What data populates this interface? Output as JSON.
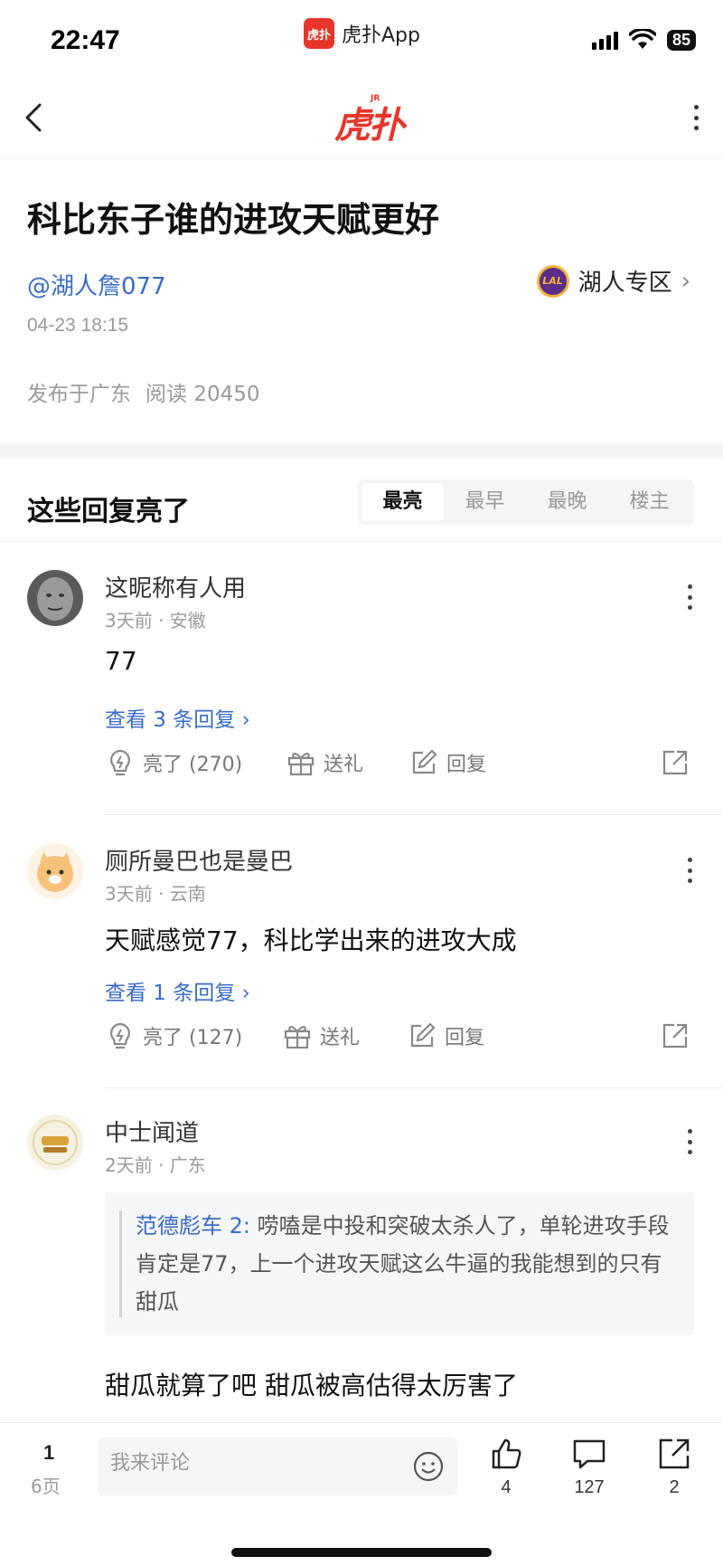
{
  "status_bar": {
    "time": "22:47",
    "app_logo": "虎扑",
    "app_name": "虎扑App",
    "battery": "85",
    "icons": [
      "signal-icon",
      "wifi-icon",
      "battery-icon"
    ]
  },
  "nav": {
    "logo": "虎扑",
    "logo_badge": "JR",
    "icons": [
      "back-icon",
      "more-icon"
    ]
  },
  "post": {
    "title": "科比东子谁的进攻天赋更好",
    "author": "@湖人詹077",
    "zone_logo": "LAL",
    "zone": "湖人专区",
    "time": "04-23 18:15",
    "location": "发布于广东",
    "read_label": "阅读",
    "reads": "20450"
  },
  "replies": {
    "title": "这些回复亮了",
    "tabs": [
      {
        "label": "最亮",
        "active": true
      },
      {
        "label": "最早",
        "active": false
      },
      {
        "label": "最晚",
        "active": false
      },
      {
        "label": "楼主",
        "active": false
      }
    ],
    "comments": [
      {
        "name": "这昵称有人用",
        "meta": "3天前 · 安徽",
        "text": "77",
        "view_replies": "查看 3 条回复 ›",
        "like": "亮了 (270)",
        "gift": "送礼",
        "reply": "回复"
      },
      {
        "name": "厕所曼巴也是曼巴",
        "meta": "3天前 · 云南",
        "text": "天赋感觉77，科比学出来的进攻大成",
        "view_replies": "查看 1 条回复 ›",
        "like": "亮了 (127)",
        "gift": "送礼",
        "reply": "回复"
      },
      {
        "name": "中士闻道",
        "meta": "2天前 · 广东",
        "quote_author": "范德彪车 2:",
        "quote_text": " 唠嗑是中投和突破太杀人了，单轮进攻手段肯定是77，上一个进攻天赋这么牛逼的我能想到的只有甜瓜",
        "text": "甜瓜就算了吧 甜瓜被高估得太厉害了"
      }
    ]
  },
  "bottom_bar": {
    "page": "1",
    "pages": "6页",
    "input_placeholder": "我来评论",
    "likes": "4",
    "comments": "127",
    "shares": "2",
    "icons": [
      "emoji-icon",
      "thumbs-up-icon",
      "comment-icon",
      "share-icon"
    ]
  },
  "colors": {
    "brand_red": "#e8352a",
    "link_blue": "#3a6bc4",
    "lakers_purple": "#5b2d8c",
    "lakers_gold": "#f2b43a"
  }
}
